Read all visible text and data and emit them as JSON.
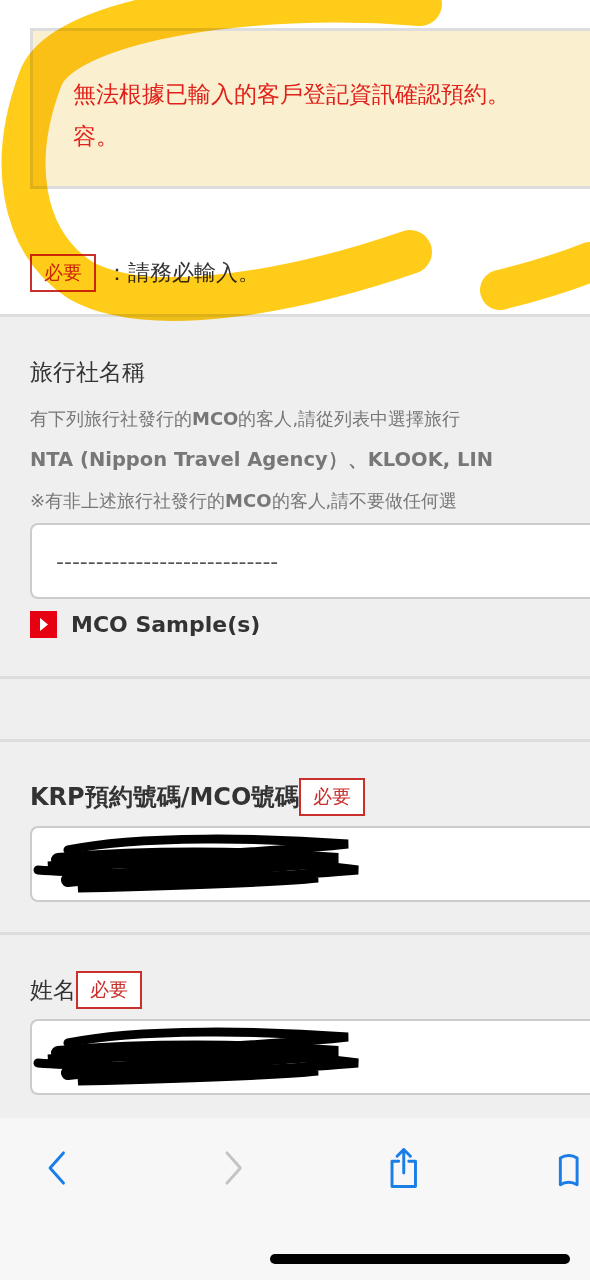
{
  "highlight": {
    "kind": "marker-stroke"
  },
  "notice": {
    "lines": [
      "無法根據已輸入的客戶登記資訊確認預約。",
      "容。"
    ]
  },
  "legend": {
    "badge": "必要",
    "text": "：請務必輸入。"
  },
  "sections": [
    {
      "kind": "select",
      "title": "旅行社名稱",
      "bold": false,
      "notes": [
        {
          "text": "有下列旅行社發行的**MCO**的客人,請從列表中選擇旅行",
          "bold": false
        },
        {
          "text": "NTA (Nippon Travel Agency）、KLOOK, LIN",
          "bold": true
        },
        {
          "text": "※有非上述旅行社發行的**MCO**的客人,請不要做任何選",
          "bold": false
        }
      ],
      "value": "----------------------------",
      "link": "MCO Sample(s)"
    },
    {
      "kind": "spacer"
    },
    {
      "kind": "input",
      "title": "KRP預約號碼/MCO號碼",
      "bold": true,
      "badge": "必要",
      "redacted": true
    },
    {
      "kind": "input",
      "title": "姓名",
      "bold": false,
      "badge": "必要",
      "redacted": true
    }
  ],
  "toolbar": [
    {
      "kind": "back",
      "disabled": false
    },
    {
      "kind": "forward",
      "disabled": true
    },
    {
      "kind": "share",
      "disabled": false
    },
    {
      "kind": "bookmarks",
      "disabled": false
    }
  ]
}
